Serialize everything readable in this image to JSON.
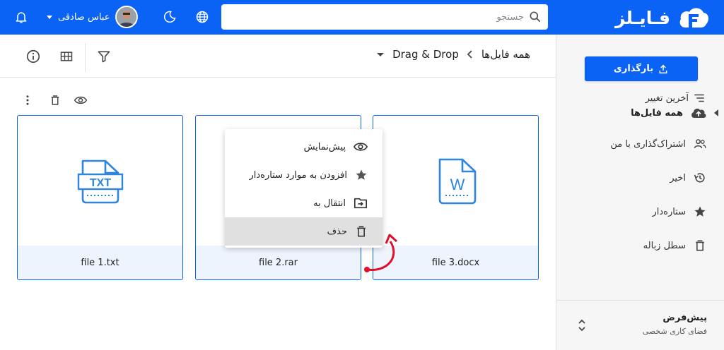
{
  "app": {
    "brand_name": "فـایـلز"
  },
  "search": {
    "placeholder": "جستجو",
    "value": ""
  },
  "user": {
    "name": "عباس صادقی"
  },
  "header_icons": [
    "bell-icon",
    "moon-icon",
    "globe-icon",
    "search-icon"
  ],
  "sidebar": {
    "upload_label": "بارگذاری",
    "items": [
      {
        "label": "همه فایل‌ها",
        "icon": "cloud-upload-icon",
        "active": true
      },
      {
        "label": "اشتراک‌گذاری با من",
        "icon": "people-icon"
      },
      {
        "label": "اخیر",
        "icon": "history-icon"
      },
      {
        "label": "ستاره‌دار",
        "icon": "star-icon"
      },
      {
        "label": "سطل زباله",
        "icon": "trash-icon"
      }
    ],
    "workspace": {
      "name": "پیش‌فرض",
      "subtitle": "فضای کاری شخصی"
    }
  },
  "breadcrumb": {
    "root": "همه فایل‌ها",
    "current": "Drag & Drop"
  },
  "sort": {
    "label": "آخرین تغییر"
  },
  "files": [
    {
      "name": "file 3.docx",
      "type": "docx",
      "icon_text": "W"
    },
    {
      "name": "file 2.rar",
      "type": "rar"
    },
    {
      "name": "file 1.txt",
      "type": "txt",
      "icon_text": "TXT"
    }
  ],
  "context_menu": {
    "items": [
      {
        "label": "پیش‌نمایش",
        "icon": "eye-icon"
      },
      {
        "label": "افزودن به موارد ستاره‌دار",
        "icon": "star-icon"
      },
      {
        "label": "انتقال به",
        "icon": "folder-move-icon"
      },
      {
        "label": "حذف",
        "icon": "trash-icon",
        "highlighted": true
      }
    ]
  },
  "colors": {
    "primary": "#0b63f6",
    "card_footer": "#eef4fd",
    "sidebar_bg": "#f6f6f6",
    "menu_hover": "#e0e0e0",
    "annotation_arrow": "#e0102a",
    "file_icon": "#2e86de"
  }
}
